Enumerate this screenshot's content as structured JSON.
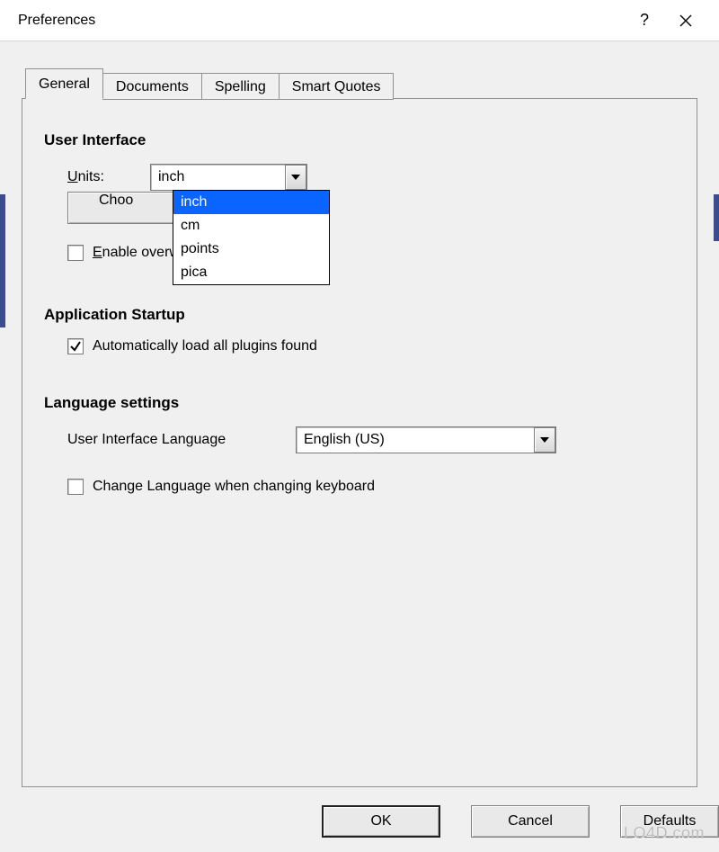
{
  "window": {
    "title": "Preferences"
  },
  "tabs": [
    "General",
    "Documents",
    "Spelling",
    "Smart Quotes"
  ],
  "active_tab": "General",
  "sections": {
    "ui": {
      "header": "User Interface",
      "units_label_prefix": "U",
      "units_label_rest": "nits:",
      "units_value": "inch",
      "units_options": [
        "inch",
        "cm",
        "points",
        "pica"
      ],
      "choose_button_prefix": "Choo",
      "enable_overwrite_prefix": "E",
      "enable_overwrite_rest": "nable overwrite mode toggle",
      "enable_overwrite_checked": false
    },
    "startup": {
      "header": "Application Startup",
      "auto_load_label": "Automatically load all plugins found",
      "auto_load_checked": true
    },
    "lang": {
      "header": "Language settings",
      "ui_lang_label": "User Interface Language",
      "ui_lang_value": "English (US)",
      "change_lang_label": "Change Language when changing keyboard",
      "change_lang_checked": false
    }
  },
  "buttons": {
    "ok": "OK",
    "cancel": "Cancel",
    "defaults": "Defaults"
  },
  "watermark": "LO4D.com"
}
